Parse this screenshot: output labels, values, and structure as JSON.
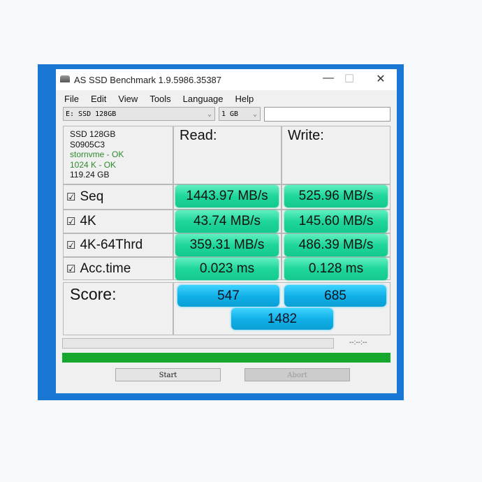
{
  "window": {
    "title": "AS SSD Benchmark 1.9.5986.35387",
    "minimize": "—",
    "maximize": "☐",
    "close": "✕"
  },
  "menu": [
    "File",
    "Edit",
    "View",
    "Tools",
    "Language",
    "Help"
  ],
  "toolbar": {
    "drive": "E: SSD 128GB",
    "size": "1 GB",
    "chevron": "⌄",
    "text": ""
  },
  "info": {
    "name": "SSD 128GB",
    "fw": "S0905C3",
    "driver": "stornvme - OK",
    "align": "1024 K - OK",
    "capacity": "119.24 GB"
  },
  "headers": {
    "read": "Read:",
    "write": "Write:"
  },
  "rows": [
    {
      "label": "Seq",
      "read": "1443.97 MB/s",
      "write": "525.96 MB/s"
    },
    {
      "label": "4K",
      "read": "43.74 MB/s",
      "write": "145.60 MB/s"
    },
    {
      "label": "4K-64Thrd",
      "read": "359.31 MB/s",
      "write": "486.39 MB/s"
    },
    {
      "label": "Acc.time",
      "read": "0.023 ms",
      "write": "0.128 ms"
    }
  ],
  "checkbox": "☑",
  "score": {
    "label": "Score:",
    "read": "547",
    "write": "685",
    "total": "1482"
  },
  "progress": {
    "time": "--:--:--",
    "value": 0,
    "total_value": 1.0
  },
  "buttons": {
    "start": "Start",
    "abort": "Abort"
  },
  "colors": {
    "result_green": "#1fd69a",
    "score_blue": "#11b1e8",
    "progress_green": "#16a82c"
  }
}
